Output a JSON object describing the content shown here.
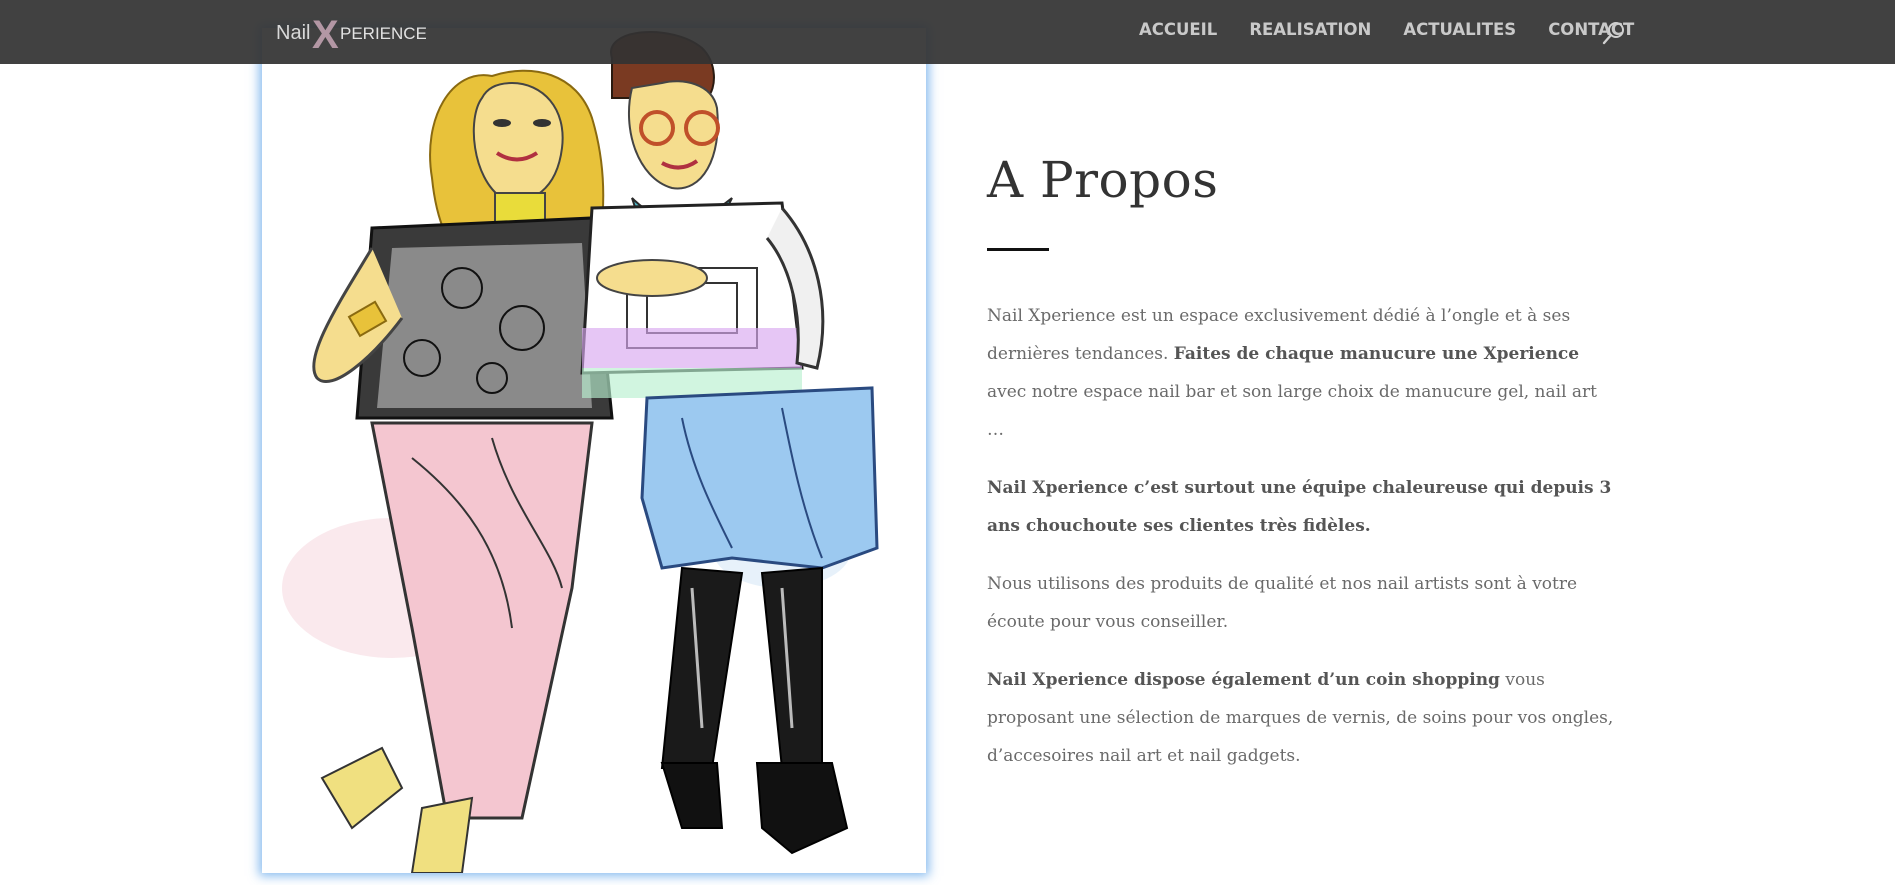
{
  "header": {
    "logo_text_a": "Nail",
    "logo_text_b": "X",
    "logo_text_c": "PERIENCE",
    "nav": [
      {
        "label": "ACCUEIL"
      },
      {
        "label": "REALISATION"
      },
      {
        "label": "ACTUALITES"
      },
      {
        "label": "CONTACT"
      }
    ],
    "search_icon": "search-icon"
  },
  "about": {
    "title": "A Propos",
    "p1_a": "Nail Xperience est un espace exclusivement dédié à l’ongle et à ses dernières tendances. ",
    "p1_b": "Faites de chaque manucure une Xperience",
    "p1_c": " avec notre espace nail bar et son large choix de manucure gel, nail art …",
    "p2": "Nail Xperience c’est surtout une équipe chaleureuse qui depuis 3 ans chouchoute ses clientes très fidèles.",
    "p3": "Nous utilisons des produits de qualité et nos nail artists sont à votre écoute pour vous conseiller.",
    "p4_a": "Nail Xperience dispose également d’un coin shopping",
    "p4_b": " vous proposant une sélection de marques de vernis, de soins pour vos ongles, d’accesoires nail art et nail gadgets."
  },
  "colors": {
    "header_bg": "#333333",
    "nav_text": "#c9c9c9",
    "accent_glow": "#4696e6"
  }
}
